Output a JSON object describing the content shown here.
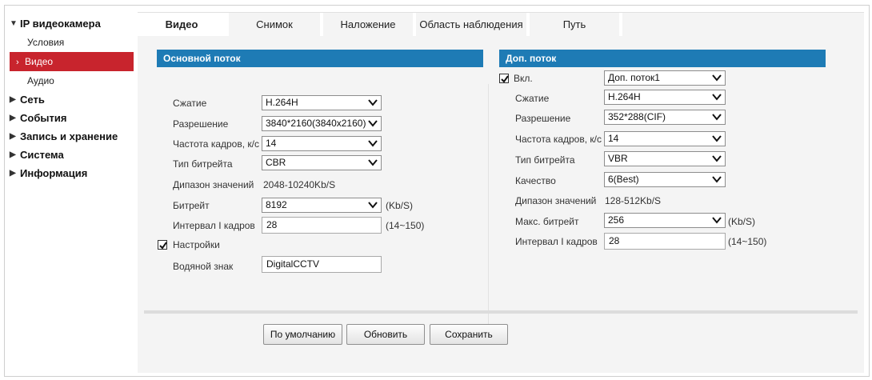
{
  "sidebar": {
    "sections": [
      {
        "label": "IP видеокамера",
        "expanded": true,
        "items": [
          {
            "label": "Условия",
            "active": false
          },
          {
            "label": "Видео",
            "active": true
          },
          {
            "label": "Аудио",
            "active": false
          }
        ]
      },
      {
        "label": "Сеть",
        "expanded": false
      },
      {
        "label": "События",
        "expanded": false
      },
      {
        "label": "Запись и хранение",
        "expanded": false
      },
      {
        "label": "Система",
        "expanded": false
      },
      {
        "label": "Информация",
        "expanded": false
      }
    ],
    "active_color": "#c8242d"
  },
  "tabs": [
    "Видео",
    "Снимок",
    "Наложение",
    "Область наблюдения",
    "Путь"
  ],
  "active_tab": "Видео",
  "main_stream": {
    "header": "Основной поток",
    "compression_label": "Сжатие",
    "compression_value": "H.264H",
    "resolution_label": "Разрешение",
    "resolution_value": "3840*2160(3840x2160)",
    "fps_label": "Частота кадров, к/с",
    "fps_value": "14",
    "bitrate_type_label": "Тип битрейта",
    "bitrate_type_value": "CBR",
    "range_label": "Дипазон значений",
    "range_value": "2048-10240Kb/S",
    "bitrate_label": "Битрейт",
    "bitrate_value": "8192",
    "bitrate_unit": "(Kb/S)",
    "iframe_label": "Интервал I кадров",
    "iframe_value": "28",
    "iframe_range": "(14~150)",
    "settings_label": "Настройки",
    "settings_checked": true,
    "watermark_label": "Водяной знак",
    "watermark_value": "DigitalCCTV"
  },
  "sub_stream": {
    "header": "Доп. поток",
    "enable_label": "Вкл.",
    "enable_checked": true,
    "stream_value": "Доп. поток1",
    "compression_label": "Сжатие",
    "compression_value": "H.264H",
    "resolution_label": "Разрешение",
    "resolution_value": "352*288(CIF)",
    "fps_label": "Частота кадров, к/с",
    "fps_value": "14",
    "bitrate_type_label": "Тип битрейта",
    "bitrate_type_value": "VBR",
    "quality_label": "Качество",
    "quality_value": "6(Best)",
    "range_label": "Дипазон значений",
    "range_value": "128-512Kb/S",
    "max_bitrate_label": "Макс. битрейт",
    "max_bitrate_value": "256",
    "max_bitrate_unit": "(Kb/S)",
    "iframe_label": "Интервал I кадров",
    "iframe_value": "28",
    "iframe_range": "(14~150)"
  },
  "buttons": {
    "default": "По умолчанию",
    "refresh": "Обновить",
    "save": "Сохранить"
  },
  "colors": {
    "header_bg": "#1e7bb5",
    "active_item": "#c8242d"
  }
}
